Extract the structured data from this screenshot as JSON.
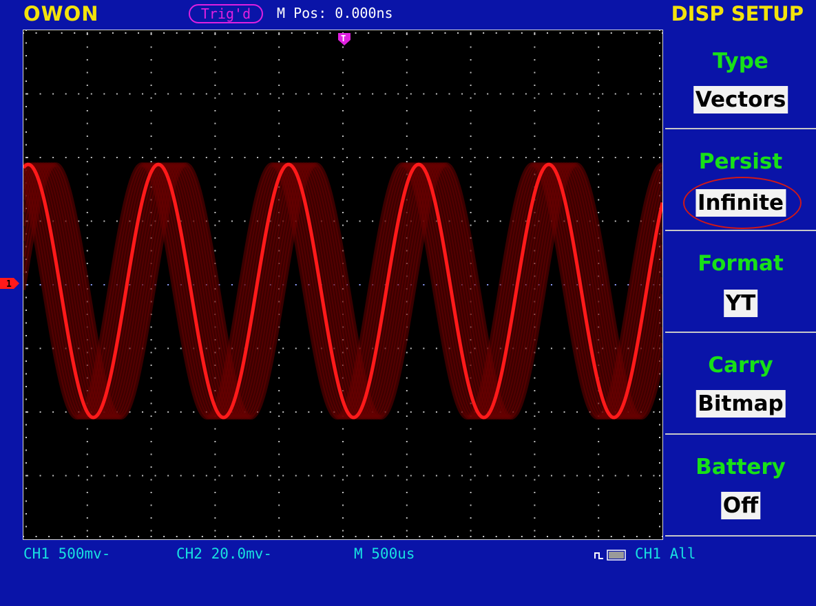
{
  "header": {
    "brand": "OWON",
    "trigger_status": "Trig'd",
    "horizontal_position": "M Pos: 0.000ns",
    "menu_title": "DISP SETUP"
  },
  "menu": {
    "items": [
      {
        "label": "Type",
        "value": "Vectors"
      },
      {
        "label": "Persist",
        "value": "Infinite"
      },
      {
        "label": "Format",
        "value": "YT"
      },
      {
        "label": "Carry",
        "value": "Bitmap"
      },
      {
        "label": "Battery",
        "value": "Off"
      }
    ]
  },
  "status": {
    "ch1_scale": "CH1 500mv-",
    "ch2_scale": "CH2 20.0mv-",
    "timebase": "M 500us",
    "trigger_source": "CH1 All"
  },
  "markers": {
    "channel_marker": "1",
    "trigger_marker": "T"
  },
  "colors": {
    "background": "#0a14a8",
    "brand": "#f2e20c",
    "menu_label": "#18e018",
    "status_text": "#18e0e0",
    "trace": "#ff1a1a",
    "persist_glow": "#6a0000",
    "trigger_marker": "#e020e0"
  },
  "icons": {
    "channel_marker_icon": "arrow-right-tab",
    "trigger_marker_icon": "trigger-pointer",
    "acquisition_icon": "square-wave-battery"
  }
}
